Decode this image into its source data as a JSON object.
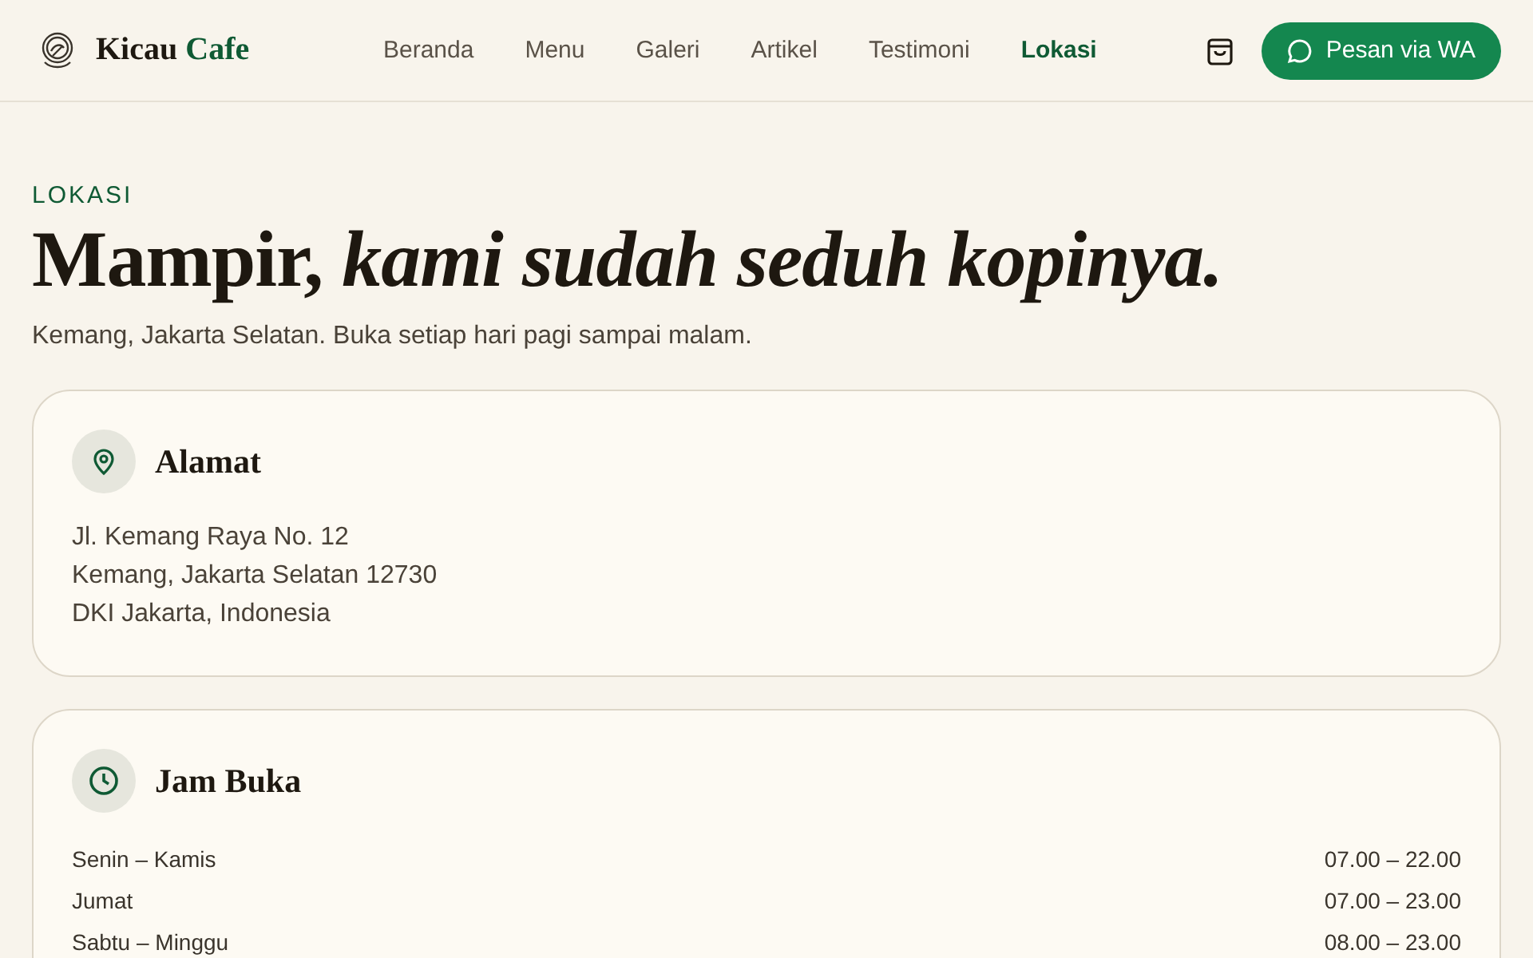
{
  "header": {
    "brand": {
      "first": "Kicau",
      "second": "Cafe"
    },
    "nav": [
      {
        "label": "Beranda",
        "selected": false
      },
      {
        "label": "Menu",
        "selected": false
      },
      {
        "label": "Galeri",
        "selected": false
      },
      {
        "label": "Artikel",
        "selected": false
      },
      {
        "label": "Testimoni",
        "selected": false
      },
      {
        "label": "Lokasi",
        "selected": true
      }
    ],
    "order_button": "Pesan via WA"
  },
  "hero": {
    "eyebrow": "LOKASI",
    "title": "Mampir, *kami sudah seduh kopinya.*",
    "subtitle": "Kemang, Jakarta Selatan. Buka setiap hari pagi sampai malam."
  },
  "cards": [
    {
      "kind": "address",
      "title": "Alamat",
      "lines": [
        "Jl. Kemang Raya No. 12",
        "Kemang, Jakarta Selatan 12730",
        "DKI Jakarta, Indonesia"
      ]
    },
    {
      "kind": "hours",
      "title": "Jam Buka",
      "rows": [
        {
          "day": "Senin – Kamis",
          "time": "07.00 – 22.00"
        },
        {
          "day": "Jumat",
          "time": "07.00 – 23.00"
        },
        {
          "day": "Sabtu – Minggu",
          "time": "08.00 – 23.00"
        }
      ]
    }
  ]
}
